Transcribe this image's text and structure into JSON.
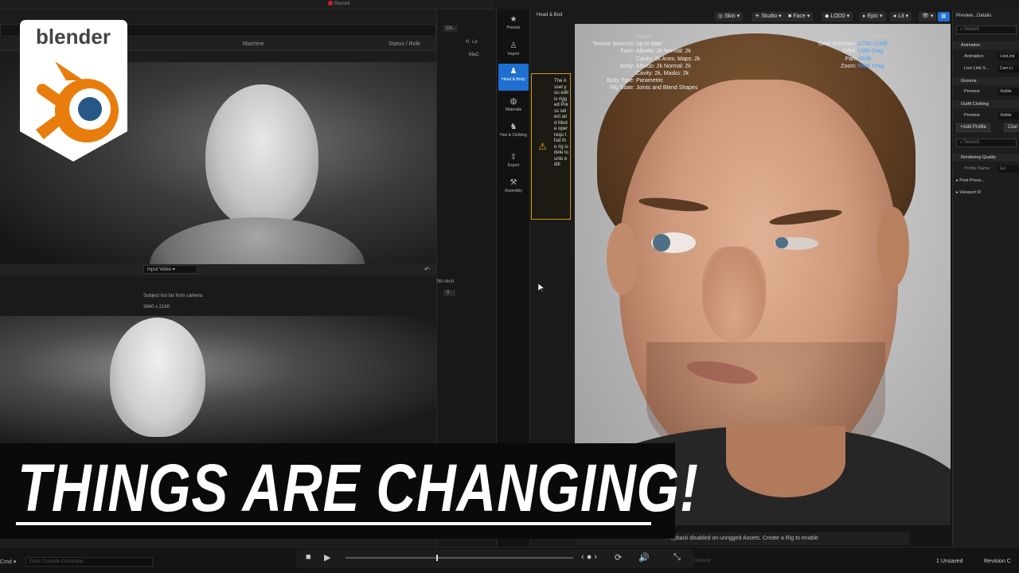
{
  "headline": "THINGS ARE CHANGING!",
  "logo": {
    "text": "blender",
    "brand_color": "#e87d0d",
    "accent_color": "#265787"
  },
  "topbar": {
    "record_label": "Record"
  },
  "left_panel": {
    "table_columns": [
      "Machine",
      "Status / Role"
    ],
    "input_video_label": "Input Video",
    "status_message": "Subject too far from camera",
    "resolution": "3840 x 2160",
    "no_record_label": "No reco",
    "counter": "0.."
  },
  "mini_col": {
    "tab_label": "Ch..",
    "col_n": "N",
    "col_le": "Le",
    "row_label": "MaC"
  },
  "sidebar": {
    "items": [
      {
        "label": "Presets",
        "icon": "star-icon"
      },
      {
        "label": "Import",
        "icon": "person-icon"
      },
      {
        "label": "Head & Body",
        "icon": "body-icon"
      },
      {
        "label": "Materials",
        "icon": "materials-icon"
      },
      {
        "label": "Hair & Clothing",
        "icon": "hair-icon"
      },
      {
        "label": "Export",
        "icon": "export-icon"
      },
      {
        "label": "Assembly",
        "icon": "hammer-icon"
      }
    ],
    "panel_title": "Head & Bod",
    "warning_text": "The Asset you edit is rigged Press select and Mode oper requ that the rig is dele to unlo editi"
  },
  "viewport_toolbar": {
    "skin": "Skin",
    "studio": "Studio",
    "face": "Face",
    "lod": "LOD0",
    "quality": "Epic",
    "lit": "Lit"
  },
  "status_info": {
    "title": "Status",
    "rows": [
      {
        "key": "Texture Sources:",
        "value": "Up to date"
      },
      {
        "key": "Face:",
        "value": "Albedo: 2k Normal: 2k"
      },
      {
        "key": "",
        "value": "Cavity: 2k Anim. Maps: 2k"
      },
      {
        "key": "Body:",
        "value": "Albedo: 2k Normal: 2k"
      },
      {
        "key": "",
        "value": "Cavity: 2k, Masks: 2k"
      },
      {
        "key": "Body Type:",
        "value": "Parametric"
      },
      {
        "key": "Rig State:",
        "value": "Joints and Blend Shapes"
      }
    ]
  },
  "hotkeys_info": {
    "title": "Hotkeys",
    "rows": [
      {
        "key": "Orbit Selection:",
        "value": "CTRL+LMB"
      },
      {
        "key": "Orbit:",
        "value": "LMB Drag"
      },
      {
        "key": "Pan:",
        "value": "MMB"
      },
      {
        "key": "Zoom:",
        "value": "RMB Drag"
      }
    ]
  },
  "playback_message": "Playback disabled on unrigged Assets. Create a Rig to enable",
  "details": {
    "title": "Preview...Details",
    "search_placeholder": "Search",
    "animation_section": "Animation",
    "animation_label": "Animation",
    "animation_value": "LiveLink",
    "livelink_label": "Live Link S...",
    "livelink_value": "Cam Li",
    "grooms_section": "Grooms",
    "grooms_preview_label": "Preview",
    "grooms_preview_value": "Visible",
    "outfit_section": "Outfit Clothing",
    "outfit_preview_label": "Preview",
    "outfit_preview_value": "Visible",
    "add_profile": "+Add Profile",
    "clone": "Clon",
    "search2_placeholder": "Search",
    "rendering_section": "Rendering Quality",
    "profile_name_label": "Profile Name",
    "profile_name_value": "Epi",
    "post_process_label": "Post Proce...",
    "viewport_label": "Viewport R"
  },
  "bottom": {
    "console_label": "Cmd",
    "console_placeholder": "Enter Console Command",
    "command_placeholder": "mmand",
    "playhead_fraction": 0.4,
    "unsaved": "1 Unsaved",
    "revision": "Revision C"
  }
}
